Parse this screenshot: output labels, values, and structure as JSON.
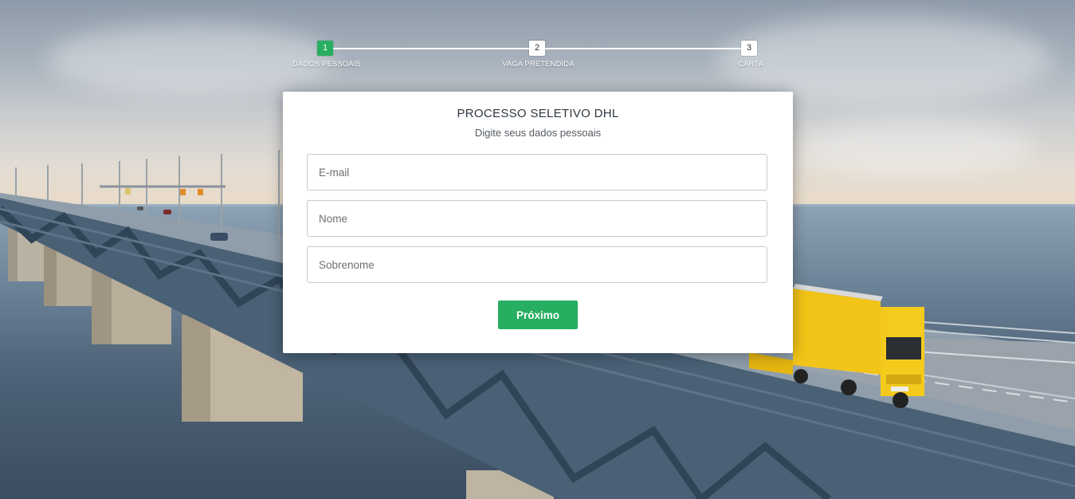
{
  "stepper": {
    "steps": [
      {
        "number": "1",
        "label": "DADOS PESSOAIS"
      },
      {
        "number": "2",
        "label": "VAGA PRETENDIDA"
      },
      {
        "number": "3",
        "label": "CARTA"
      }
    ],
    "active_step": 1
  },
  "form": {
    "title": "PROCESSO SELETIVO DHL",
    "subtitle": "Digite seus dados pessoais",
    "email_placeholder": "E-mail",
    "name_placeholder": "Nome",
    "surname_placeholder": "Sobrenome",
    "next_label": "Próximo"
  },
  "colors": {
    "accent": "#27ae60",
    "card": "#ffffff",
    "truck": "#f2c417"
  }
}
